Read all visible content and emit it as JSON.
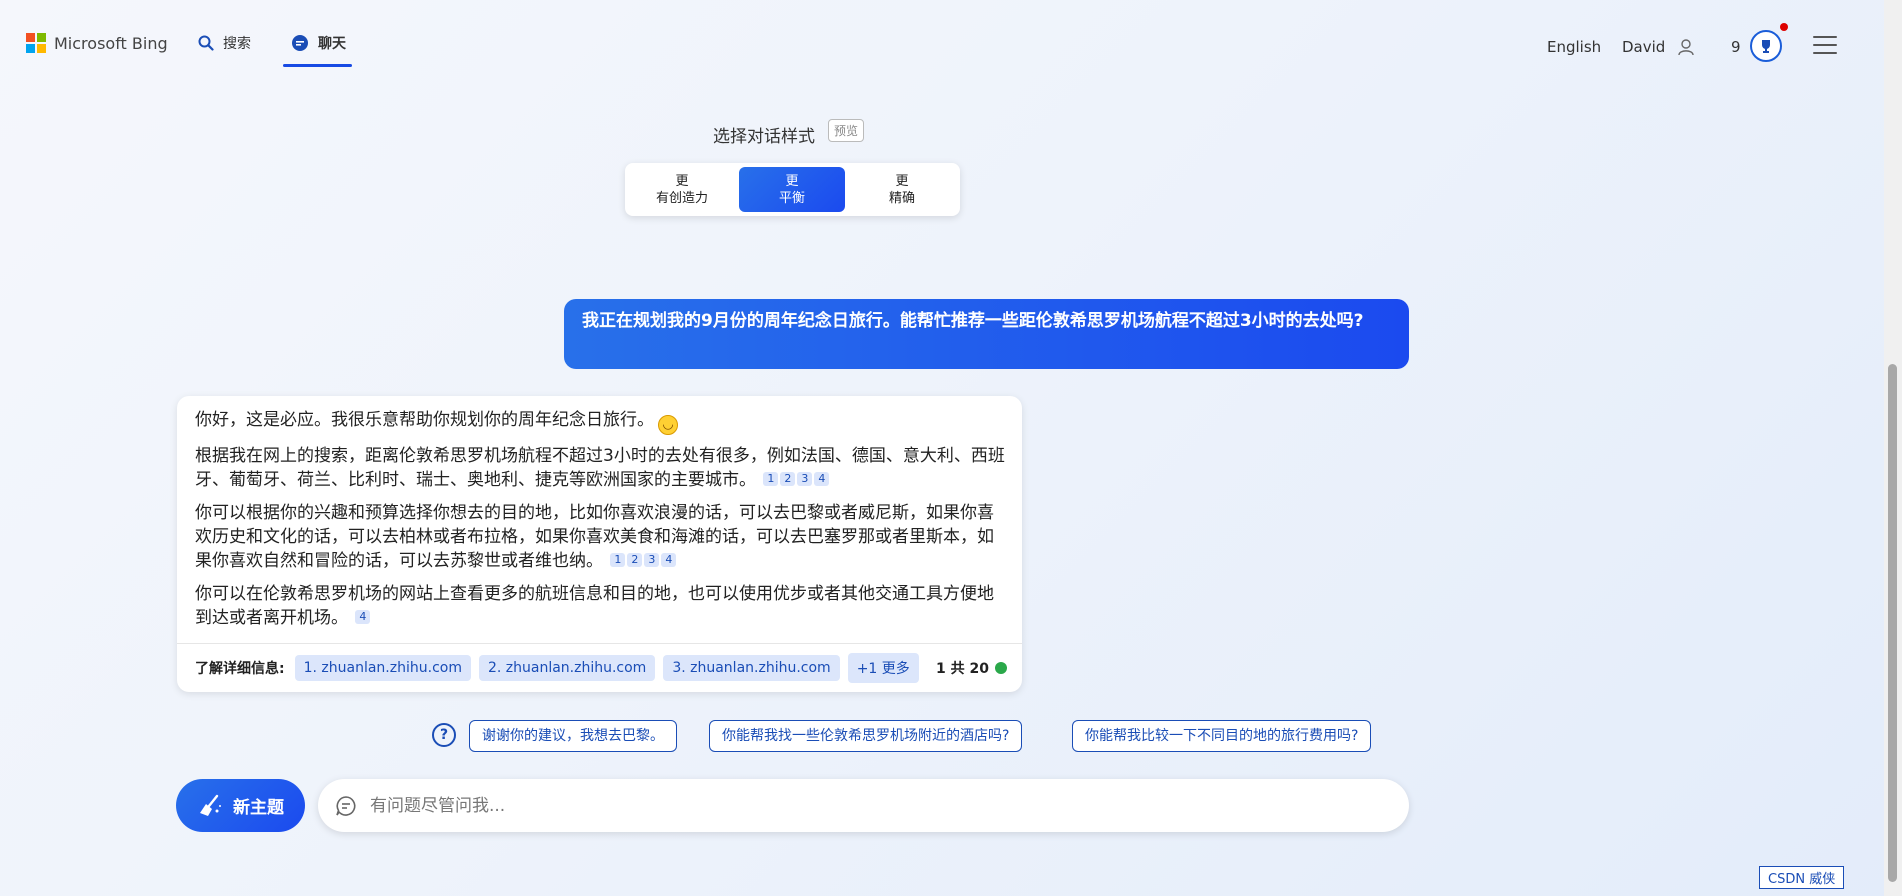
{
  "header": {
    "logo_text": "Microsoft Bing",
    "nav_search": "搜索",
    "nav_chat": "聊天",
    "language": "English",
    "user_name": "David",
    "rewards_count": "9"
  },
  "style_selector": {
    "title": "选择对话样式",
    "badge": "预览",
    "options": [
      {
        "line1": "更",
        "line2": "有创造力",
        "selected": false
      },
      {
        "line1": "更",
        "line2": "平衡",
        "selected": true
      },
      {
        "line1": "更",
        "line2": "精确",
        "selected": false
      }
    ]
  },
  "user_message": "我正在规划我的9月份的周年纪念日旅行。能帮忙推荐一些距伦敦希思罗机场航程不超过3小时的去处吗?",
  "bot_response": {
    "p1": "你好，这是必应。我很乐意帮助你规划你的周年纪念日旅行。",
    "p2": "根据我在网上的搜索，距离伦敦希思罗机场航程不超过3小时的去处有很多，例如法国、德国、意大利、西班牙、葡萄牙、荷兰、比利时、瑞士、奥地利、捷克等欧洲国家的主要城市。",
    "p2_cites": [
      "1",
      "2",
      "3",
      "4"
    ],
    "p3": "你可以根据你的兴趣和预算选择你想去的目的地，比如你喜欢浪漫的话，可以去巴黎或者威尼斯，如果你喜欢历史和文化的话，可以去柏林或者布拉格，如果你喜欢美食和海滩的话，可以去巴塞罗那或者里斯本，如果你喜欢自然和冒险的话，可以去苏黎世或者维也纳。",
    "p3_cites": [
      "1",
      "2",
      "3",
      "4"
    ],
    "p4": "你可以在伦敦希思罗机场的网站上查看更多的航班信息和目的地，也可以使用优步或者其他交通工具方便地到达或者离开机场。",
    "p4_cites": [
      "4"
    ],
    "learn_more_label": "了解详细信息:",
    "sources": [
      "1. zhuanlan.zhihu.com",
      "2. zhuanlan.zhihu.com",
      "3. zhuanlan.zhihu.com"
    ],
    "more_label": "+1 更多",
    "page_count": "1 共 20"
  },
  "suggestions": [
    "谢谢你的建议，我想去巴黎。",
    "你能帮我找一些伦敦希思罗机场附近的酒店吗?",
    "你能帮我比较一下不同目的地的旅行费用吗?"
  ],
  "input": {
    "new_topic_label": "新主题",
    "placeholder": "有问题尽管问我..."
  },
  "watermark": "CSDN 威侠",
  "colors": {
    "accent": "#1b4aef",
    "link": "#1a4db6",
    "status_green": "#2aa84a"
  }
}
